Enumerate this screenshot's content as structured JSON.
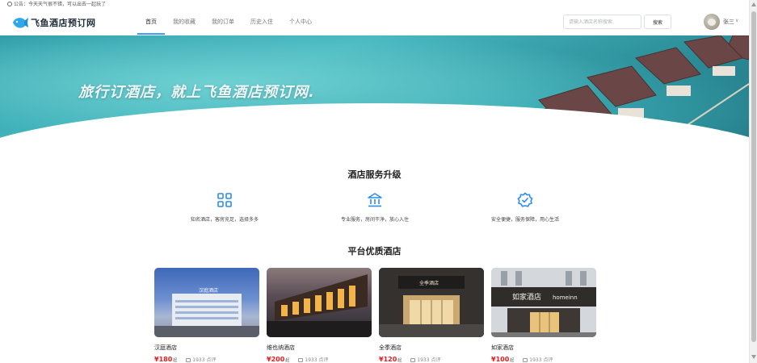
{
  "notice": {
    "text": "公告：今天天气很不错，可以出去一起玩了"
  },
  "header": {
    "logo_text": "飞鱼酒店预订网",
    "nav": [
      {
        "label": "首页",
        "active": true
      },
      {
        "label": "我的收藏",
        "active": false
      },
      {
        "label": "我的订单",
        "active": false
      },
      {
        "label": "历史入住",
        "active": false
      },
      {
        "label": "个人中心",
        "active": false
      }
    ],
    "search_placeholder": "请输入酒店名称搜索",
    "search_button": "搜索",
    "user_name": "张三",
    "user_caret": "∨"
  },
  "banner": {
    "slogan": "旅行订酒店，就上飞鱼酒店预订网."
  },
  "services": {
    "title": "酒店服务升级",
    "items": [
      {
        "icon": "grid-icon",
        "text": "知名酒店，客房充足，选择多多"
      },
      {
        "icon": "bank-icon",
        "text": "专业服务，房间干净，放心入住"
      },
      {
        "icon": "badge-check-icon",
        "text": "安全便捷，服务保障，用心生活"
      }
    ]
  },
  "hotels": {
    "title": "平台优质酒店",
    "items": [
      {
        "name": "汉庭酒店",
        "price": "¥180",
        "unit": "起",
        "reviews": "1933 点评"
      },
      {
        "name": "维也纳酒店",
        "price": "¥200",
        "unit": "起",
        "reviews": "1933 点评"
      },
      {
        "name": "全季酒店",
        "price": "¥120",
        "unit": "起",
        "reviews": "1933 点评"
      },
      {
        "name": "如家酒店",
        "price": "¥100",
        "unit": "起",
        "reviews": "1933 点评"
      }
    ],
    "signage": [
      "汉庭酒店",
      "全季酒店",
      "如家酒店",
      "homeinn"
    ]
  },
  "colors": {
    "accent": "#409eff",
    "price": "#e02020",
    "service_icon": "#2d8cf0"
  }
}
